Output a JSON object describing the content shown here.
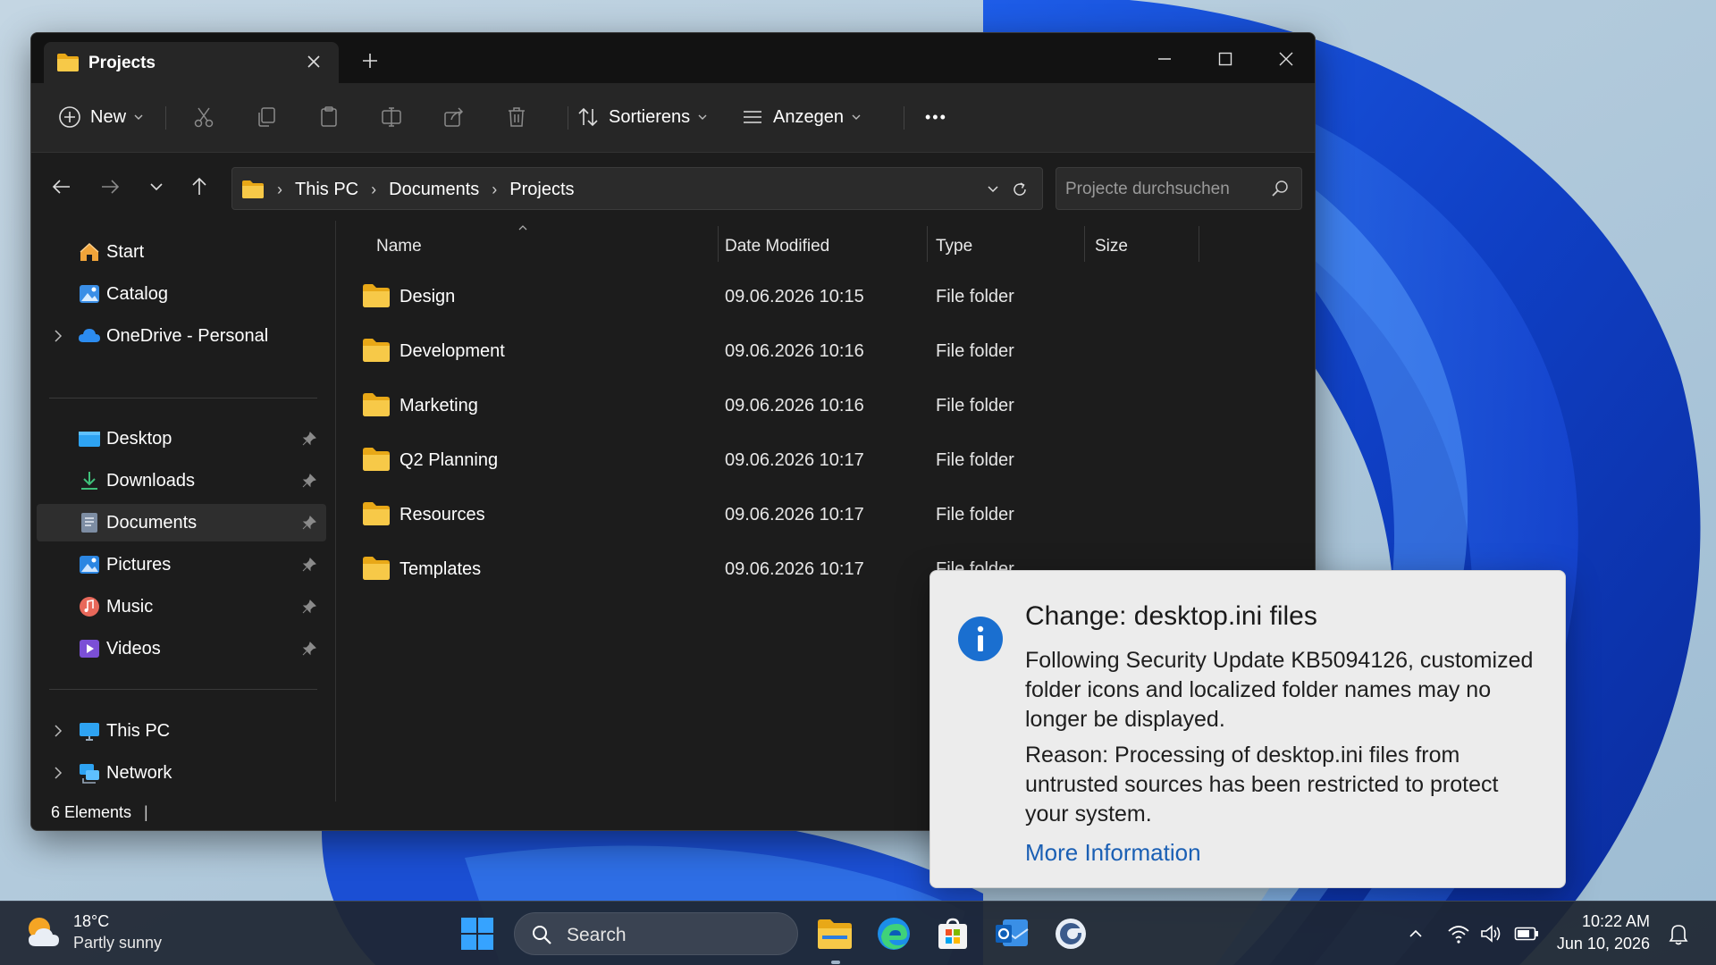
{
  "window": {
    "tab_title": "Projects",
    "toolbar": {
      "new_label": "New",
      "sort_label": "Sortierens",
      "view_label": "Anzegen",
      "more_label": "•••"
    },
    "address": {
      "crumbs": [
        "This PC",
        "Documents",
        "Projects"
      ]
    },
    "search_placeholder": "Projecte durchsuchen",
    "sidebar": {
      "items": [
        {
          "label": "Start"
        },
        {
          "label": "Catalog"
        },
        {
          "label": "OneDrive - Personal"
        },
        {
          "label": "Desktop"
        },
        {
          "label": "Downloads"
        },
        {
          "label": "Documents"
        },
        {
          "label": "Pictures"
        },
        {
          "label": "Music"
        },
        {
          "label": "Videos"
        },
        {
          "label": "This PC"
        },
        {
          "label": "Network"
        }
      ]
    },
    "columns": {
      "name": "Name",
      "date": "Date Modified",
      "type": "Type",
      "size": "Size"
    },
    "files": [
      {
        "name": "Design",
        "date": "09.06.2026 10:15",
        "type": "File folder"
      },
      {
        "name": "Development",
        "date": "09.06.2026 10:16",
        "type": "File folder"
      },
      {
        "name": "Marketing",
        "date": "09.06.2026 10:16",
        "type": "File folder"
      },
      {
        "name": "Q2 Planning",
        "date": "09.06.2026 10:17",
        "type": "File folder"
      },
      {
        "name": "Resources",
        "date": "09.06.2026 10:17",
        "type": "File folder"
      },
      {
        "name": "Templates",
        "date": "09.06.2026 10:17",
        "type": "File folder"
      }
    ],
    "status": "6 Elements",
    "status_sep": "|"
  },
  "notification": {
    "title": "Change: desktop.ini files",
    "body": "Following Security Update KB5094126, customized folder icons and localized folder names may no longer be displayed.",
    "reason": "Reason: Processing of desktop.ini files from untrusted sources has been restricted to protect your system.",
    "link": "More Information"
  },
  "taskbar": {
    "weather_temp": "18°C",
    "weather_condition": "Partly sunny",
    "search_label": "Search",
    "time": "10:22 AM",
    "date": "Jun 10, 2026"
  },
  "colors": {
    "accent": "#1a5fb4",
    "folder": "#f5c542",
    "window_bg": "#1c1c1c",
    "toast_bg": "#ececec"
  }
}
